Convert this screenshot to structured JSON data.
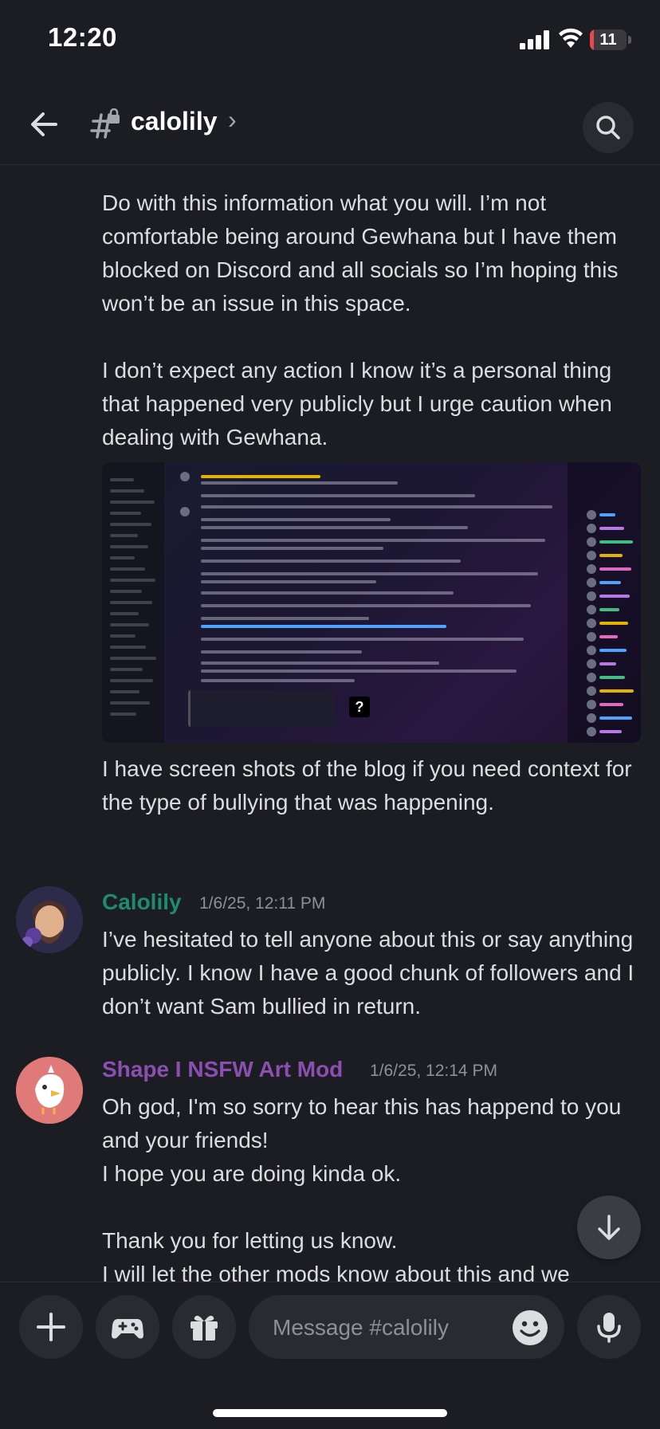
{
  "status_bar": {
    "time": "12:20",
    "battery": "11",
    "battery_level": 0.11
  },
  "header": {
    "channel_name": "calolily",
    "chevron": "›"
  },
  "messages": [
    {
      "paragraphs": [
        "Do with this information what you will. I’m not comfortable being around Gewhana but I have them blocked on Discord and all socials so I’m hoping this won’t be an issue in this space.",
        "I don’t expect any action I know it’s a personal thing that happened very publicly but I urge caution when dealing with Gewhana."
      ],
      "after_image": "I have screen shots of the blog if you need context for the type of bullying that was happening."
    },
    {
      "author": "Calolily",
      "author_color": "#1f8b6e",
      "timestamp": "1/6/25, 12:11 PM",
      "text": "I’ve hesitated to tell anyone about this or say anything publicly. I know I have a good chunk of followers and I don’t want Sam bullied in return."
    },
    {
      "author": "Shape I NSFW Art Mod",
      "author_color": "#8a4fb0",
      "timestamp": "1/6/25, 12:14 PM",
      "text": "Oh god, I'm so sorry to hear this has happend to you and your friends!\nI hope you are doing kinda ok.\n\nThank you for letting us know.\nI will let the other mods know about this and we"
    }
  ],
  "composer": {
    "placeholder": "Message #calolily"
  },
  "icons": {
    "back": "arrow-left-icon",
    "channel": "hashtag-lock-icon",
    "search": "search-icon",
    "add": "plus-icon",
    "games": "gamepad-icon",
    "gift": "gift-icon",
    "emoji": "emoji-icon",
    "mic": "microphone-icon",
    "jump": "arrow-down-icon"
  }
}
